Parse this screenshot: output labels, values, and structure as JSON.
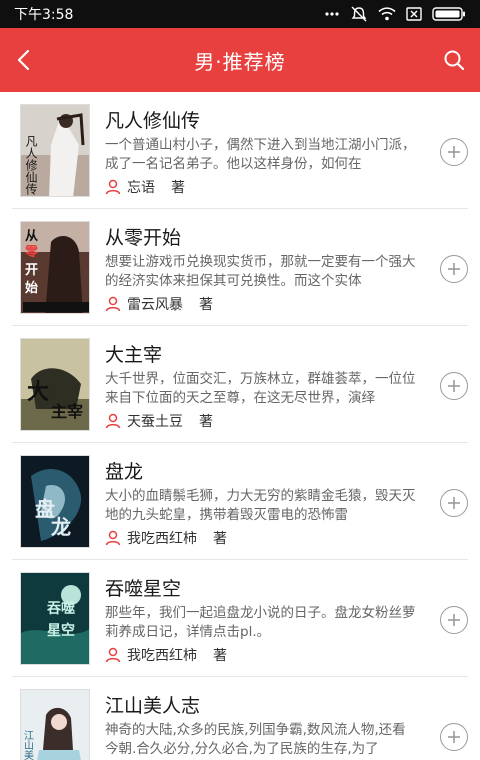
{
  "status_bar": {
    "time": "下午3:58",
    "icons": [
      "more-dots-icon",
      "mute-icon",
      "wifi-icon",
      "sim-x-icon",
      "battery-icon"
    ]
  },
  "nav": {
    "title": "男·推荐榜",
    "back_icon": "chevron-left-icon",
    "search_icon": "search-icon"
  },
  "colors": {
    "brand": "#e8403f",
    "status_bg": "#0f0f0f",
    "author_icon": "#e8403f"
  },
  "books": [
    {
      "title": "凡人修仙传",
      "desc": "一个普通山村小子，偶然下进入到当地江湖小门派，成了一名记名弟子。他以这样身份，如何在",
      "author": "忘语",
      "suffix": "著",
      "cover_text": "凡人修仙传"
    },
    {
      "title": "从零开始",
      "desc": "想要让游戏币兑换现实货币，那就一定要有一个强大的经济实体来担保其可兑换性。而这个实体",
      "author": "雷云风暴",
      "suffix": "著",
      "cover_text": "从零开始"
    },
    {
      "title": "大主宰",
      "desc": "大千世界，位面交汇，万族林立，群雄荟萃，一位位来自下位面的天之至尊，在这无尽世界，演绎",
      "author": "天蚕土豆",
      "suffix": "著",
      "cover_text": "大主宰"
    },
    {
      "title": "盘龙",
      "desc": "大小的血睛鬃毛狮，力大无穷的紫睛金毛猿，毁天灭地的九头蛇皇，携带着毁灭雷电的恐怖雷",
      "author": "我吃西红柿",
      "suffix": "著",
      "cover_text": "盘龙"
    },
    {
      "title": "吞噬星空",
      "desc": "那些年，我们一起追盘龙小说的日子。盘龙女粉丝萝莉养成日记，详情点击pl.。",
      "author": "我吃西红柿",
      "suffix": "著",
      "cover_text": "吞噬星空"
    },
    {
      "title": "江山美人志",
      "desc": "神奇的大陆,众多的民族,列国争霸,数风流人物,还看今朝.合久必分,分久必合,为了民族的生存,为了",
      "author": "",
      "suffix": "",
      "cover_text": "江山美人志"
    }
  ]
}
